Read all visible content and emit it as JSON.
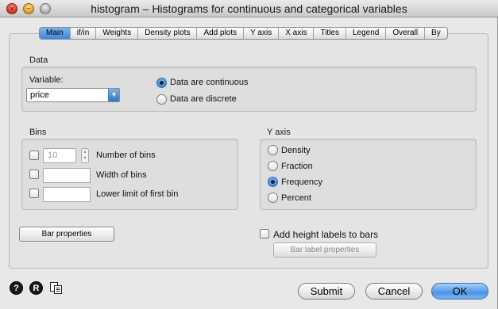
{
  "window": {
    "title": "histogram – Histograms for continuous and categorical variables",
    "controls": {
      "close": "×",
      "minimize": "–"
    }
  },
  "tabs": [
    {
      "label": "Main",
      "active": true
    },
    {
      "label": "if/in"
    },
    {
      "label": "Weights"
    },
    {
      "label": "Density plots"
    },
    {
      "label": "Add plots"
    },
    {
      "label": "Y axis"
    },
    {
      "label": "X axis"
    },
    {
      "label": "Titles"
    },
    {
      "label": "Legend"
    },
    {
      "label": "Overall"
    },
    {
      "label": "By"
    }
  ],
  "data_group": {
    "title": "Data",
    "variable_label": "Variable:",
    "variable_value": "price",
    "radio_continuous": "Data are continuous",
    "radio_discrete": "Data are discrete",
    "selected": "continuous"
  },
  "bins_group": {
    "title": "Bins",
    "number_value": "10",
    "number_label": "Number of bins",
    "width_label": "Width of bins",
    "lower_label": "Lower limit of first bin"
  },
  "yaxis_group": {
    "title": "Y axis",
    "options": [
      "Density",
      "Fraction",
      "Frequency",
      "Percent"
    ],
    "selected": "Frequency"
  },
  "bar_properties_label": "Bar properties",
  "height_labels_label": "Add height labels to bars",
  "bar_label_properties_label": "Bar label properties",
  "footer": {
    "help_glyph": "?",
    "reset_glyph": "R",
    "submit_label": "Submit",
    "cancel_label": "Cancel",
    "ok_label": "OK"
  }
}
